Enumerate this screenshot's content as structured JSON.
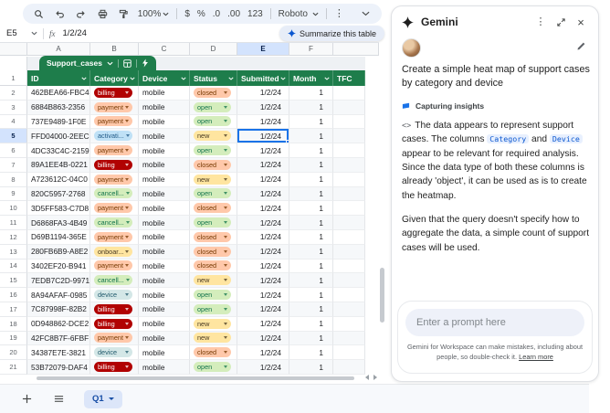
{
  "toolbar": {
    "zoom": "100%",
    "currency": "$",
    "percent": "%",
    "decrease_decimal": ".0",
    "increase_decimal": ".00",
    "number_format": "123",
    "font_name": "Roboto",
    "more": "⋮"
  },
  "formula_bar": {
    "cell_ref": "E5",
    "fx_label": "fx",
    "value": "1/2/24",
    "summarize_label": "Summarize this table"
  },
  "column_letters": [
    "A",
    "B",
    "C",
    "D",
    "E",
    "F"
  ],
  "selected_cell": "E5",
  "table": {
    "tab_name": "Support_cases",
    "header_row_num": "1",
    "headers": [
      "ID",
      "Category",
      "Device",
      "Status",
      "Submitted",
      "Month",
      "TFC"
    ],
    "rows": [
      {
        "num": 2,
        "id": "462BEA66-FBC4",
        "cat": "billing",
        "cat_label": "billing",
        "device": "mobile",
        "status": "closed",
        "status_label": "closed",
        "submitted": "1/2/24",
        "month": "1"
      },
      {
        "num": 3,
        "id": "6884B863-2356",
        "cat": "payment",
        "cat_label": "payment",
        "device": "mobile",
        "status": "open",
        "status_label": "open",
        "submitted": "1/2/24",
        "month": "1"
      },
      {
        "num": 4,
        "id": "737E9489-1F0E",
        "cat": "payment",
        "cat_label": "payment",
        "device": "mobile",
        "status": "open",
        "status_label": "open",
        "submitted": "1/2/24",
        "month": "1"
      },
      {
        "num": 5,
        "id": "FFD04000-2EEC",
        "cat": "activation",
        "cat_label": "activati...",
        "device": "mobile",
        "status": "new",
        "status_label": "new",
        "submitted": "1/2/24",
        "month": "1",
        "selected": true
      },
      {
        "num": 6,
        "id": "4DC33C4C-2159",
        "cat": "payment",
        "cat_label": "payment",
        "device": "mobile",
        "status": "open",
        "status_label": "open",
        "submitted": "1/2/24",
        "month": "1"
      },
      {
        "num": 7,
        "id": "89A1EE4B-0221",
        "cat": "billing",
        "cat_label": "billing",
        "device": "mobile",
        "status": "closed",
        "status_label": "closed",
        "submitted": "1/2/24",
        "month": "1"
      },
      {
        "num": 8,
        "id": "A723612C-04C0",
        "cat": "payment",
        "cat_label": "payment",
        "device": "mobile",
        "status": "new",
        "status_label": "new",
        "submitted": "1/2/24",
        "month": "1"
      },
      {
        "num": 9,
        "id": "820C5957-2768",
        "cat": "cancellation",
        "cat_label": "cancell...",
        "device": "mobile",
        "status": "open",
        "status_label": "open",
        "submitted": "1/2/24",
        "month": "1"
      },
      {
        "num": 10,
        "id": "3D5FF583-C7D8",
        "cat": "payment",
        "cat_label": "payment",
        "device": "mobile",
        "status": "closed",
        "status_label": "closed",
        "submitted": "1/2/24",
        "month": "1"
      },
      {
        "num": 11,
        "id": "D6868FA3-4B49",
        "cat": "cancellation",
        "cat_label": "cancell...",
        "device": "mobile",
        "status": "open",
        "status_label": "open",
        "submitted": "1/2/24",
        "month": "1"
      },
      {
        "num": 12,
        "id": "D69B1194-365E",
        "cat": "payment",
        "cat_label": "payment",
        "device": "mobile",
        "status": "closed",
        "status_label": "closed",
        "submitted": "1/2/24",
        "month": "1"
      },
      {
        "num": 13,
        "id": "280FB6B9-A8E2",
        "cat": "onboarding",
        "cat_label": "onboar...",
        "device": "mobile",
        "status": "closed",
        "status_label": "closed",
        "submitted": "1/2/24",
        "month": "1"
      },
      {
        "num": 14,
        "id": "3402EF20-B941",
        "cat": "payment",
        "cat_label": "payment",
        "device": "mobile",
        "status": "closed",
        "status_label": "closed",
        "submitted": "1/2/24",
        "month": "1"
      },
      {
        "num": 15,
        "id": "7EDB7C2D-9971",
        "cat": "cancellation",
        "cat_label": "cancell...",
        "device": "mobile",
        "status": "new",
        "status_label": "new",
        "submitted": "1/2/24",
        "month": "1"
      },
      {
        "num": 16,
        "id": "8A94AFAF-0985",
        "cat": "device",
        "cat_label": "device",
        "device": "mobile",
        "status": "open",
        "status_label": "open",
        "submitted": "1/2/24",
        "month": "1"
      },
      {
        "num": 17,
        "id": "7C87998F-82B2",
        "cat": "billing",
        "cat_label": "billing",
        "device": "mobile",
        "status": "open",
        "status_label": "open",
        "submitted": "1/2/24",
        "month": "1"
      },
      {
        "num": 18,
        "id": "0D948862-DCE2",
        "cat": "billing",
        "cat_label": "billing",
        "device": "mobile",
        "status": "new",
        "status_label": "new",
        "submitted": "1/2/24",
        "month": "1"
      },
      {
        "num": 19,
        "id": "42FC8B7F-6FBF",
        "cat": "payment",
        "cat_label": "payment",
        "device": "mobile",
        "status": "new",
        "status_label": "new",
        "submitted": "1/2/24",
        "month": "1"
      },
      {
        "num": 20,
        "id": "34387E7E-3821",
        "cat": "device",
        "cat_label": "device",
        "device": "mobile",
        "status": "closed",
        "status_label": "closed",
        "submitted": "1/2/24",
        "month": "1"
      },
      {
        "num": 21,
        "id": "53B72079-DAF4",
        "cat": "billing",
        "cat_label": "billing",
        "device": "mobile",
        "status": "open",
        "status_label": "open",
        "submitted": "1/2/24",
        "month": "1"
      }
    ]
  },
  "sheet_bar": {
    "active_tab": "Q1"
  },
  "gemini": {
    "title": "Gemini",
    "user_prompt": "Create a simple heat map of support cases by category and device",
    "status_label": "Capturing insights",
    "code_icon": "<>",
    "response_p1a": "The data appears to represent support cases. The columns ",
    "response_code1": "Category",
    "response_p1b": " and ",
    "response_code2": "Device",
    "response_p1c": " appear to be relevant for required analysis. Since the data type of both these columns is already 'object', it can be used as is to create the heatmap.",
    "response_p2": "Given that the query doesn't specify how to aggregate the data, a simple count of support cases will be used.",
    "input_placeholder": "Enter a prompt here",
    "disclaimer": "Gemini for Workspace can make mistakes, including about people, so double-check it.",
    "learn_more": "Learn more"
  },
  "colors": {
    "table_green": "#1E7D4B",
    "selection_blue": "#1A73E8",
    "selected_header_bg": "#D3E3FD",
    "toolbar_bg": "#EDF2FA",
    "chip_billing_bg": "#B10202",
    "chip_billing_text": "#FFFFFF",
    "chip_payment_bg": "#FFC8AA",
    "chip_payment_text": "#753800",
    "chip_activation_bg": "#BFE1F6",
    "chip_activation_text": "#215A87",
    "chip_cancellation_bg": "#D4EDBC",
    "chip_cancellation_text": "#11734B",
    "chip_onboarding_bg": "#FFE5A0",
    "chip_onboarding_text": "#473821",
    "chip_device_bg": "#D4E7E7",
    "chip_device_text": "#215A6C",
    "chip_open_bg": "#D4EDBC",
    "chip_open_text": "#11734B",
    "chip_closed_bg": "#FFC8AA",
    "chip_closed_text": "#753800",
    "chip_new_bg": "#FFE5A0",
    "chip_new_text": "#473821",
    "gemini_accent": "#1A73E8",
    "active_sheet_tab_bg": "#DCE6F9",
    "active_sheet_tab_text": "#174EA6"
  }
}
